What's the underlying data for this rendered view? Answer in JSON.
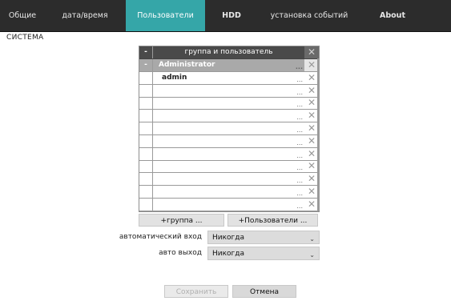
{
  "tabs": [
    {
      "label": "Общие",
      "active": false
    },
    {
      "label": "дата/время",
      "active": false
    },
    {
      "label": "Пользователи",
      "active": true
    },
    {
      "label": "HDD",
      "active": false
    },
    {
      "label": "установка событий",
      "active": false
    },
    {
      "label": "About",
      "active": false
    }
  ],
  "section_title": "СИСТЕМА",
  "table": {
    "header": "группа и пользователь",
    "collapse_symbol": "-",
    "rows": [
      {
        "name": "Administrator",
        "symbol": "-",
        "type": "group"
      },
      {
        "name": "admin",
        "symbol": "",
        "type": "user"
      },
      {
        "name": "",
        "symbol": "",
        "type": "empty"
      },
      {
        "name": "",
        "symbol": "",
        "type": "empty"
      },
      {
        "name": "",
        "symbol": "",
        "type": "empty"
      },
      {
        "name": "",
        "symbol": "",
        "type": "empty"
      },
      {
        "name": "",
        "symbol": "",
        "type": "empty"
      },
      {
        "name": "",
        "symbol": "",
        "type": "empty"
      },
      {
        "name": "",
        "symbol": "",
        "type": "empty"
      },
      {
        "name": "",
        "symbol": "",
        "type": "empty"
      },
      {
        "name": "",
        "symbol": "",
        "type": "empty"
      },
      {
        "name": "",
        "symbol": "",
        "type": "empty"
      }
    ],
    "delete_symbol": "✕",
    "ellipsis": "..."
  },
  "buttons": {
    "add_group": "+группа  ...",
    "add_user": "+Пользователи ..."
  },
  "auto_login": {
    "label": "автоматический вход",
    "value": "Никогда"
  },
  "auto_logout": {
    "label": "авто выход",
    "value": "Никогда"
  },
  "footer": {
    "save": "Сохранить",
    "cancel": "Отмена"
  },
  "colors": {
    "active_tab": "#35a6a8",
    "tabbar": "#2c2c2c"
  }
}
